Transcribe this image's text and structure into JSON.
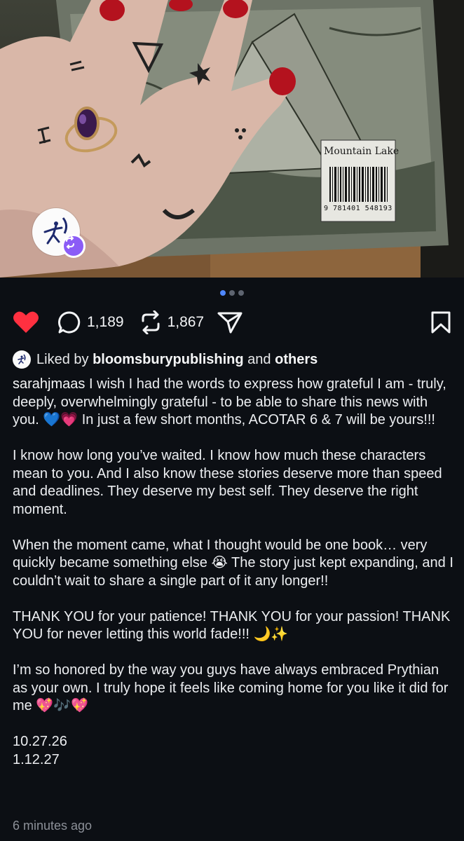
{
  "photo": {
    "alt_label_on_book": "Mountain Lake",
    "barcode_number": "9 781401 548193"
  },
  "carousel": {
    "count": 3,
    "active_index": 0
  },
  "actions": {
    "comments": "1,189",
    "reposts": "1,867"
  },
  "liked_by": {
    "prefix": "Liked by",
    "account": "bloomsburypublishing",
    "conjunction": "and",
    "others": "others"
  },
  "post": {
    "author": "sarahjmaas",
    "intro": "I wish I had the words to express how grateful I am - truly, deeply, overwhelmingly grateful - to be able to share this news with you. 💙💗 In just a few short months, ACOTAR 6 & 7 will be yours!!!",
    "paragraphs": [
      "I know how long you’ve waited. I know how much these characters mean to you. And I also know these stories deserve more than speed and deadlines. They deserve my best self. They deserve the right moment.",
      "When the moment came, what I thought would be one book… very quickly became something else 😭 The story just kept expanding, and I couldn’t wait to share a single part of it any longer!!",
      "THANK YOU for your patience! THANK YOU for your passion! THANK YOU for never letting this world fade!!! 🌙✨",
      "I’m so honored by the way you guys have always embraced Prythian as your own. I truly hope it feels like coming home for you like it did for me 💖🎶💖"
    ],
    "dates": [
      "10.27.26",
      "1.12.27"
    ]
  },
  "timestamp": "6 minutes ago",
  "colors": {
    "background": "#0c0f14",
    "heart": "#ff3040",
    "active_dot": "#4f87ff",
    "repost_badge": "#8b5cf6"
  },
  "icons": [
    "heart-icon",
    "comment-icon",
    "repost-icon",
    "share-icon",
    "bookmark-icon"
  ]
}
